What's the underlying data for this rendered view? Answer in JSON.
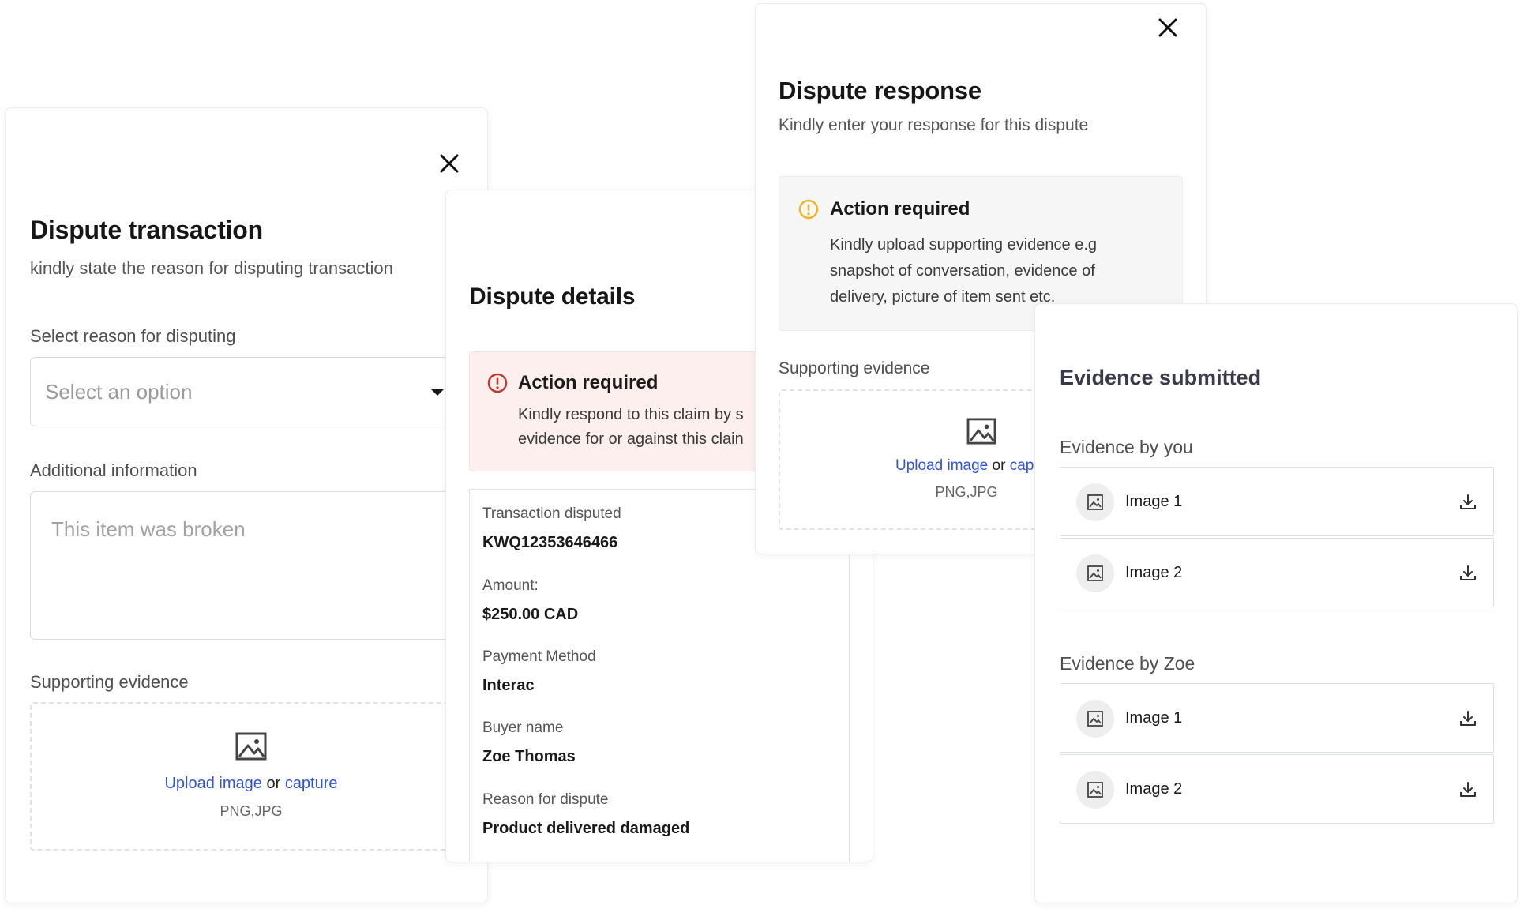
{
  "dispute_transaction": {
    "title": "Dispute transaction",
    "subtitle": "kindly state the reason for disputing transaction",
    "reason_label": "Select reason for disputing",
    "reason_placeholder": "Select an option",
    "additional_label": "Additional information",
    "additional_placeholder": "This item was broken",
    "evidence_label": "Supporting evidence",
    "upload_link": "Upload image",
    "or_text": "or",
    "capture_link": "capture",
    "file_types": "PNG,JPG",
    "icons": {
      "close": "close-icon",
      "caret": "caret-down-icon",
      "image": "image-icon"
    }
  },
  "dispute_details": {
    "title": "Dispute details",
    "alert": {
      "title": "Action required",
      "line1": "Kindly respond to this claim by s",
      "line2": "evidence for or against this clain",
      "color": "#c0392b"
    },
    "fields": [
      {
        "label": "Transaction disputed",
        "value": "KWQ12353646466"
      },
      {
        "label": "Amount:",
        "value": "$250.00 CAD"
      },
      {
        "label": "Payment Method",
        "value": "Interac"
      },
      {
        "label": "Buyer name",
        "value": "Zoe Thomas"
      },
      {
        "label": "Reason for dispute",
        "value": "Product delivered damaged"
      }
    ]
  },
  "dispute_response": {
    "title": "Dispute response",
    "subtitle": "Kindly enter your response for this dispute",
    "alert": {
      "title": "Action required",
      "line1": "Kindly upload supporting evidence e.g",
      "line2": "snapshot of conversation, evidence of",
      "line3": "delivery, picture of item sent etc.",
      "color": "#f0b429"
    },
    "evidence_label": "Supporting evidence",
    "upload_link": "Upload image",
    "or_text": "or",
    "capture_link": "cap",
    "file_types": "PNG,JPG"
  },
  "evidence_submitted": {
    "title": "Evidence submitted",
    "by_you_label": "Evidence by you",
    "by_you": [
      {
        "name": "Image 1"
      },
      {
        "name": "Image 2"
      }
    ],
    "by_zoe_label": "Evidence by Zoe",
    "by_zoe": [
      {
        "name": "Image 1"
      },
      {
        "name": "Image 2"
      }
    ],
    "icons": {
      "thumb": "image-icon",
      "download": "download-icon"
    }
  },
  "colors": {
    "link": "#2f55d4",
    "alert_red_bg": "#fcefee",
    "alert_grey_bg": "#f6f6f6"
  }
}
